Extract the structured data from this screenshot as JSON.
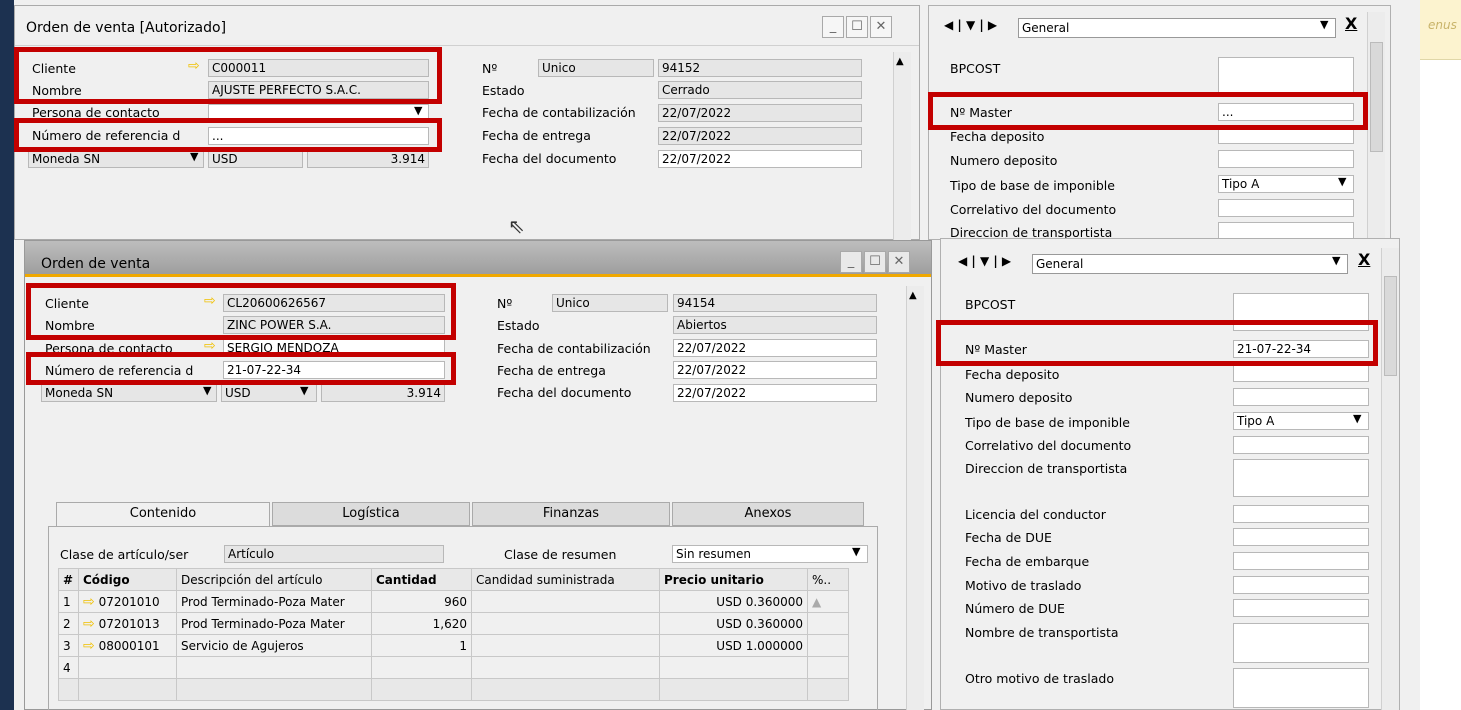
{
  "w1": {
    "title": "Orden de venta [Autorizado]",
    "cliente_label": "Cliente",
    "cliente": "C000011",
    "nombre_label": "Nombre",
    "nombre": "AJUSTE PERFECTO S.A.C.",
    "contacto_label": "Persona de contacto",
    "ref_label": "Número de referencia d",
    "ref": "...",
    "moneda_label": "Moneda SN",
    "moneda": "USD",
    "tc": "3.914",
    "no_label": "Nº",
    "serie": "Unico",
    "no": "94152",
    "estado_label": "Estado",
    "estado": "Cerrado",
    "fcont_label": "Fecha de contabilización",
    "fcont": "22/07/2022",
    "fent_label": "Fecha de entrega",
    "fent": "22/07/2022",
    "fdoc_label": "Fecha del documento",
    "fdoc": "22/07/2022"
  },
  "p1": {
    "combo": "General",
    "bpcost": "BPCOST",
    "master_label": "Nº Master",
    "master": "...",
    "fdep": "Fecha deposito",
    "ndep": "Numero deposito",
    "tipo_label": "Tipo de base de imponible",
    "tipo": "Tipo A",
    "correl": "Correlativo del documento",
    "direc": "Direccion de transportista"
  },
  "bg_text": "enus",
  "w2": {
    "title": "Orden de venta",
    "cliente_label": "Cliente",
    "cliente": "CL20600626567",
    "nombre_label": "Nombre",
    "nombre": "ZINC POWER S.A.",
    "contacto_label": "Persona de contacto",
    "contacto": "SERGIO MENDOZA",
    "ref_label": "Número de referencia d",
    "ref": "21-07-22-34",
    "moneda_label": "Moneda SN",
    "moneda": "USD",
    "tc": "3.914",
    "no_label": "Nº",
    "serie": "Unico",
    "no": "94154",
    "estado_label": "Estado",
    "estado": "Abiertos",
    "fcont_label": "Fecha de contabilización",
    "fcont": "22/07/2022",
    "fent_label": "Fecha de entrega",
    "fent": "22/07/2022",
    "fdoc_label": "Fecha del documento",
    "fdoc": "22/07/2022",
    "tabs": [
      "Contenido",
      "Logística",
      "Finanzas",
      "Anexos"
    ],
    "clase_label": "Clase de artículo/ser",
    "clase": "Artículo",
    "resumen_label": "Clase de resumen",
    "resumen": "Sin resumen",
    "cols": [
      "#",
      "Código",
      "Descripción del artículo",
      "Cantidad",
      "Candidad suministrada",
      "Precio unitario",
      "%.."
    ],
    "rows": [
      {
        "n": "1",
        "cod": "07201010",
        "desc": "Prod Terminado-Poza Mater",
        "cant": "960",
        "precio": "USD 0.360000"
      },
      {
        "n": "2",
        "cod": "07201013",
        "desc": "Prod Terminado-Poza Mater",
        "cant": "1,620",
        "precio": "USD 0.360000"
      },
      {
        "n": "3",
        "cod": "08000101",
        "desc": "Servicio de Agujeros",
        "cant": "1",
        "precio": "USD 1.000000"
      },
      {
        "n": "4",
        "cod": "",
        "desc": "",
        "cant": "",
        "precio": ""
      }
    ]
  },
  "p2": {
    "combo": "General",
    "bpcost": "BPCOST",
    "master_label": "Nº Master",
    "master": "21-07-22-34",
    "fdep": "Fecha deposito",
    "ndep": "Numero deposito",
    "tipo_label": "Tipo de base de imponible",
    "tipo": "Tipo A",
    "correl": "Correlativo del documento",
    "direc": "Direccion de transportista",
    "licencia": "Licencia del conductor",
    "fdue": "Fecha de DUE",
    "femb": "Fecha de embarque",
    "motivo": "Motivo de traslado",
    "ndue": "Número de DUE",
    "ntrans": "Nombre de transportista",
    "otro": "Otro motivo de traslado"
  }
}
